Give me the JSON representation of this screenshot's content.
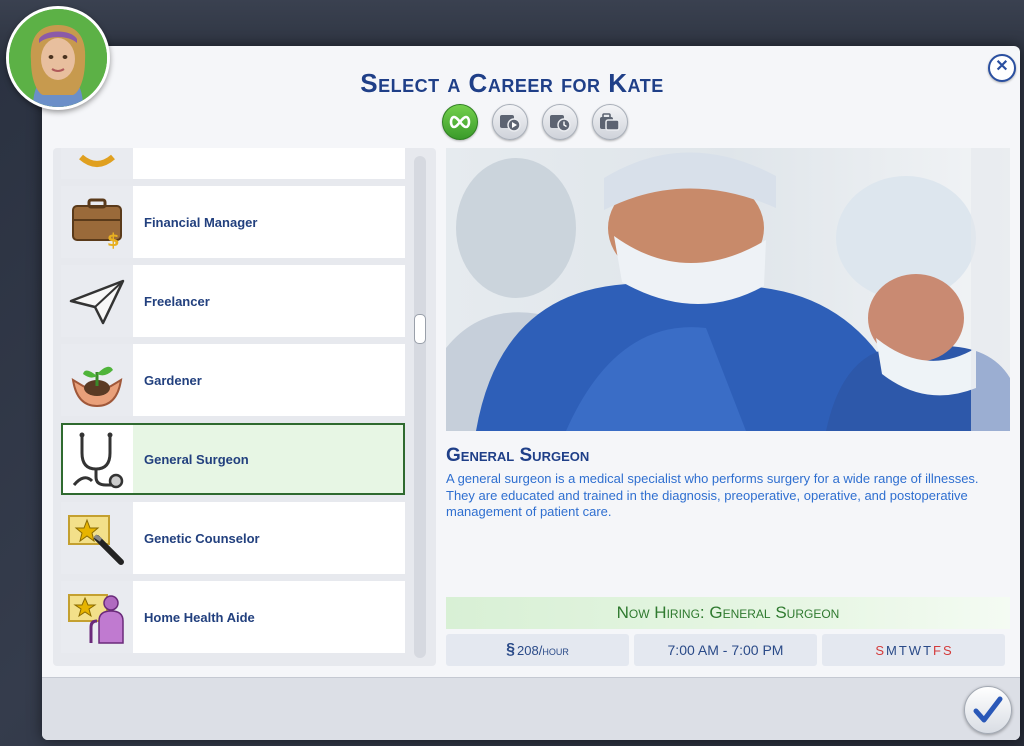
{
  "dialog": {
    "title": "Select a Career for Kate",
    "close_icon": "close-icon"
  },
  "filters": [
    {
      "icon": "infinity-icon",
      "active": true
    },
    {
      "icon": "career-play-icon",
      "active": false
    },
    {
      "icon": "career-clock-icon",
      "active": false
    },
    {
      "icon": "career-briefcase-icon",
      "active": false
    }
  ],
  "careers": [
    {
      "label": "",
      "icon": "partial-career-icon"
    },
    {
      "label": "Financial Manager",
      "icon": "briefcase-money-icon"
    },
    {
      "label": "Freelancer",
      "icon": "paper-plane-icon"
    },
    {
      "label": "Gardener",
      "icon": "plant-hands-icon"
    },
    {
      "label": "General Surgeon",
      "icon": "stethoscope-icon",
      "selected": true
    },
    {
      "label": "Genetic Counselor",
      "icon": "star-pen-icon"
    },
    {
      "label": "Home Health Aide",
      "icon": "star-person-icon"
    }
  ],
  "selected_career": {
    "name": "General Surgeon",
    "description": "A general surgeon is a medical specialist who performs surgery for a wide range of illnesses. They are educated and trained in the diagnosis, preoperative, operative, and postoperative management of patient care.",
    "hiring_label": "Now Hiring: General Surgeon",
    "pay_symbol": "§",
    "pay": "208/hour",
    "hours": "7:00 AM - 7:00 PM",
    "days": [
      {
        "d": "S",
        "on": true
      },
      {
        "d": "M",
        "on": false
      },
      {
        "d": "T",
        "on": false
      },
      {
        "d": "W",
        "on": false
      },
      {
        "d": "T",
        "on": false
      },
      {
        "d": "F",
        "on": true
      },
      {
        "d": "S",
        "on": true
      }
    ]
  },
  "colors": {
    "accent": "#1f3f88",
    "hiring_green": "#2f7a2f",
    "workday_red": "#d43b3b",
    "offday_blue": "#2a4a88"
  }
}
